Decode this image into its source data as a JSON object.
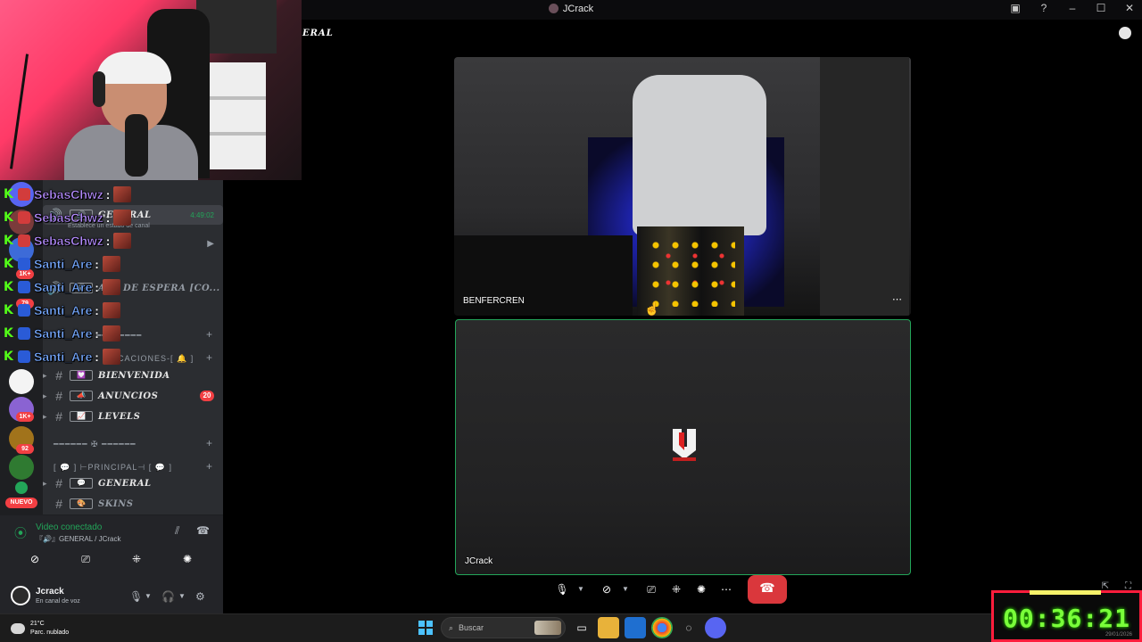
{
  "window": {
    "title": "JCrack"
  },
  "main": {
    "section_title": "ERAL",
    "tiles": [
      {
        "name": "BENFERCREN"
      },
      {
        "name": "JCrack"
      }
    ]
  },
  "sidebar": {
    "channels": [
      {
        "label": "GENERAL",
        "emoji": "🔊",
        "time": "4:49:02",
        "sub": "Establece un estado de canal"
      },
      {
        "label": "ALA DE ESPERA [CO...",
        "emoji": "🔊"
      },
      {
        "label": "BIENVENIDA",
        "emoji": "💟"
      },
      {
        "label": "ANUNCIOS",
        "emoji": "📣",
        "badge": "20"
      },
      {
        "label": "LEVELS",
        "emoji": "📈"
      },
      {
        "label": "GENERAL",
        "emoji": "💬"
      },
      {
        "label": "SKINS",
        "emoji": "🎨"
      }
    ],
    "categories": [
      {
        "label": "FICACIONES-[ 🔔 ]"
      },
      {
        "label": "━━━━━━━━"
      },
      {
        "label": "━━━━━━  ✠  ━━━━━━"
      },
      {
        "label": "[ 💬 ] ⊢PRINCIPAL⊣ [ 💬 ]"
      }
    ],
    "server_badges": [
      "1K+",
      "79",
      "1K+",
      "92"
    ],
    "nuevo_label": "NUEVO"
  },
  "chat": [
    {
      "user": "SebasChwz",
      "color": "purple"
    },
    {
      "user": "SebasChwz",
      "color": "purple"
    },
    {
      "user": "SebasChwz",
      "color": "purple"
    },
    {
      "user": "Santi_Are",
      "color": "blue"
    },
    {
      "user": "Santi_Are",
      "color": "blue"
    },
    {
      "user": "Santi_Are",
      "color": "blue"
    },
    {
      "user": "Santi_Are",
      "color": "blue"
    },
    {
      "user": "Santi_Are",
      "color": "blue"
    }
  ],
  "voice": {
    "status": "Video conectado",
    "channel": "『🔊』GENERAL / JCrack"
  },
  "user": {
    "name": "Jcrack",
    "status": "En canal de voz"
  },
  "taskbar": {
    "weather_temp": "21°C",
    "weather_desc": "Parc. nublado",
    "search_placeholder": "Buscar"
  },
  "timer": {
    "value": "00:36:21",
    "footer": "29/01/2026"
  },
  "colors": {
    "accent_green": "#23a559",
    "hangup_red": "#da373c",
    "timer_green": "#7aff3a",
    "timer_border": "#ff1d3c"
  }
}
